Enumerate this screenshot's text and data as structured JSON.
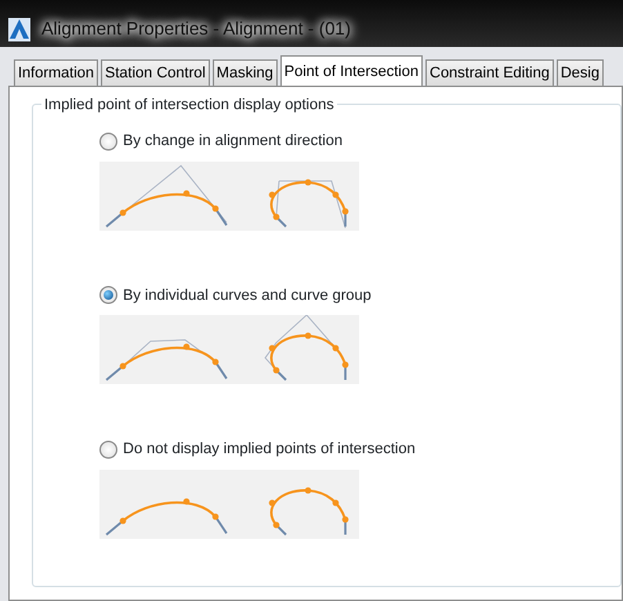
{
  "window": {
    "title": "Alignment Properties - Alignment - (01)"
  },
  "tabs": [
    {
      "label": "Information",
      "selected": false
    },
    {
      "label": "Station Control",
      "selected": false
    },
    {
      "label": "Masking",
      "selected": false
    },
    {
      "label": "Point of Intersection",
      "selected": true
    },
    {
      "label": "Constraint Editing",
      "selected": false
    },
    {
      "label": "Desig",
      "selected": false
    }
  ],
  "group": {
    "title": "Implied point of intersection display options",
    "options": [
      {
        "label": "By change in alignment direction",
        "selected": false,
        "kind": "direction"
      },
      {
        "label": "By individual curves and curve group",
        "selected": true,
        "kind": "individual"
      },
      {
        "label": "Do not display implied points of intersection",
        "selected": false,
        "kind": "none"
      }
    ]
  }
}
